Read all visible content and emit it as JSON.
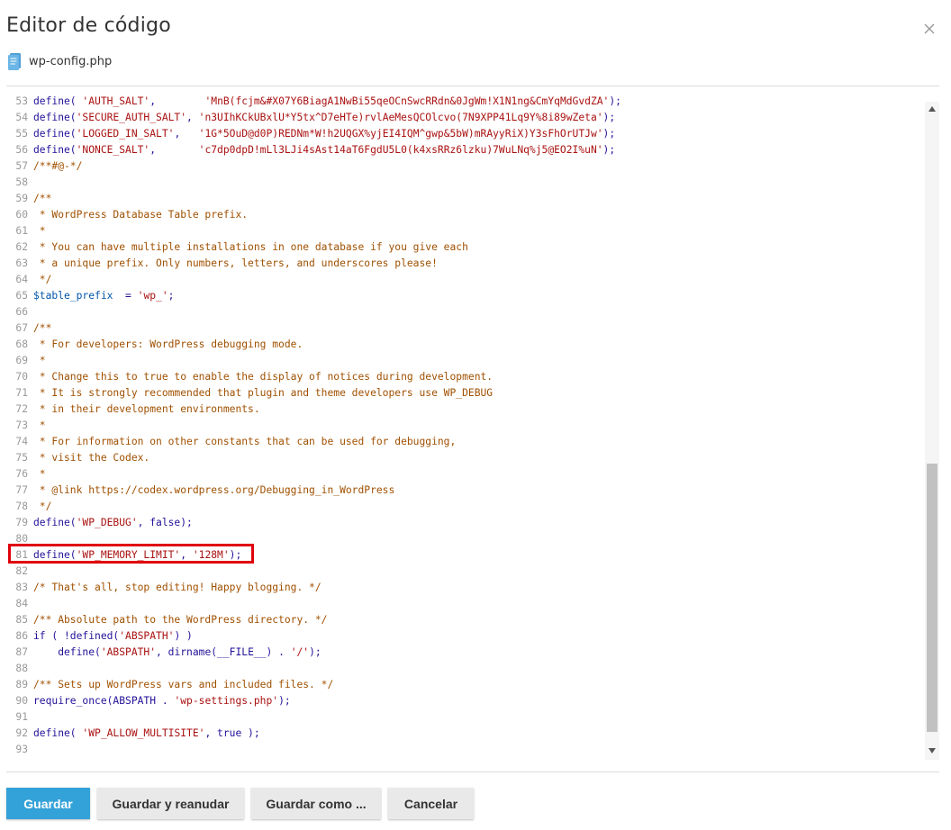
{
  "dialog": {
    "title": "Editor de código",
    "filename": "wp-config.php"
  },
  "code_lines": [
    {
      "n": "53",
      "t": [
        [
          "plain",
          "define( "
        ],
        [
          "str",
          "'AUTH_SALT'"
        ],
        [
          "plain",
          ",        "
        ],
        [
          "str",
          "'MnB(fcjm&#X07Y6BiagA1NwBi55qeOCnSwcRRdn&0JgWm!X1N1ng&CmYqMdGvdZA'"
        ],
        [
          "plain",
          ");"
        ]
      ]
    },
    {
      "n": "54",
      "t": [
        [
          "plain",
          "define("
        ],
        [
          "str",
          "'SECURE_AUTH_SALT'"
        ],
        [
          "plain",
          ", "
        ],
        [
          "str",
          "'n3UIhKCkUBxlU*Y5tx^D7eHTe)rvlAeMesQCOlcvo(7N9XPP41Lq9Y%8i89wZeta'"
        ],
        [
          "plain",
          ");"
        ]
      ]
    },
    {
      "n": "55",
      "t": [
        [
          "plain",
          "define("
        ],
        [
          "str",
          "'LOGGED_IN_SALT'"
        ],
        [
          "plain",
          ",   "
        ],
        [
          "str",
          "'1G*5OuD@d0P)REDNm*W!h2UQGX%yjEI4IQM^gwp&5bW)mRAyyRiX)Y3sFhOrUTJw'"
        ],
        [
          "plain",
          ");"
        ]
      ]
    },
    {
      "n": "56",
      "t": [
        [
          "plain",
          "define("
        ],
        [
          "str",
          "'NONCE_SALT'"
        ],
        [
          "plain",
          ",       "
        ],
        [
          "str",
          "'c7dp0dpD!mLl3LJi4sAst14aT6FgdU5L0(k4xsRRz6lzku)7WuLNq%j5@EO2I%uN'"
        ],
        [
          "plain",
          ");"
        ]
      ]
    },
    {
      "n": "57",
      "t": [
        [
          "cm",
          "/**#@-*/"
        ]
      ]
    },
    {
      "n": "58",
      "t": []
    },
    {
      "n": "59",
      "t": [
        [
          "cm",
          "/**"
        ]
      ]
    },
    {
      "n": "60",
      "t": [
        [
          "cm",
          " * WordPress Database Table prefix."
        ]
      ]
    },
    {
      "n": "61",
      "t": [
        [
          "cm",
          " *"
        ]
      ]
    },
    {
      "n": "62",
      "t": [
        [
          "cm",
          " * You can have multiple installations in one database if you give each"
        ]
      ]
    },
    {
      "n": "63",
      "t": [
        [
          "cm",
          " * a unique prefix. Only numbers, letters, and underscores please!"
        ]
      ]
    },
    {
      "n": "64",
      "t": [
        [
          "cm",
          " */"
        ]
      ]
    },
    {
      "n": "65",
      "t": [
        [
          "var",
          "$table_prefix"
        ],
        [
          "plain",
          "  = "
        ],
        [
          "str",
          "'wp_'"
        ],
        [
          "plain",
          ";"
        ]
      ]
    },
    {
      "n": "66",
      "t": []
    },
    {
      "n": "67",
      "t": [
        [
          "cm",
          "/**"
        ]
      ]
    },
    {
      "n": "68",
      "t": [
        [
          "cm",
          " * For developers: WordPress debugging mode."
        ]
      ]
    },
    {
      "n": "69",
      "t": [
        [
          "cm",
          " *"
        ]
      ]
    },
    {
      "n": "70",
      "t": [
        [
          "cm",
          " * Change this to true to enable the display of notices during development."
        ]
      ]
    },
    {
      "n": "71",
      "t": [
        [
          "cm",
          " * It is strongly recommended that plugin and theme developers use WP_DEBUG"
        ]
      ]
    },
    {
      "n": "72",
      "t": [
        [
          "cm",
          " * in their development environments."
        ]
      ]
    },
    {
      "n": "73",
      "t": [
        [
          "cm",
          " *"
        ]
      ]
    },
    {
      "n": "74",
      "t": [
        [
          "cm",
          " * For information on other constants that can be used for debugging,"
        ]
      ]
    },
    {
      "n": "75",
      "t": [
        [
          "cm",
          " * visit the Codex."
        ]
      ]
    },
    {
      "n": "76",
      "t": [
        [
          "cm",
          " *"
        ]
      ]
    },
    {
      "n": "77",
      "t": [
        [
          "cm",
          " * @link https://codex.wordpress.org/Debugging_in_WordPress"
        ]
      ]
    },
    {
      "n": "78",
      "t": [
        [
          "cm",
          " */"
        ]
      ]
    },
    {
      "n": "79",
      "t": [
        [
          "plain",
          "define("
        ],
        [
          "str",
          "'WP_DEBUG'"
        ],
        [
          "plain",
          ", false);"
        ]
      ]
    },
    {
      "n": "80",
      "t": []
    },
    {
      "n": "81",
      "t": [
        [
          "plain",
          "define("
        ],
        [
          "str",
          "'WP_MEMORY_LIMIT'"
        ],
        [
          "plain",
          ", "
        ],
        [
          "str",
          "'128M'"
        ],
        [
          "plain",
          ");"
        ]
      ]
    },
    {
      "n": "82",
      "t": []
    },
    {
      "n": "83",
      "t": [
        [
          "cm",
          "/* That's all, stop editing! Happy blogging. */"
        ]
      ]
    },
    {
      "n": "84",
      "t": []
    },
    {
      "n": "85",
      "t": [
        [
          "cm",
          "/** Absolute path to the WordPress directory. */"
        ]
      ]
    },
    {
      "n": "86",
      "t": [
        [
          "plain",
          "if ( !defined("
        ],
        [
          "str",
          "'ABSPATH'"
        ],
        [
          "plain",
          ") )"
        ]
      ]
    },
    {
      "n": "87",
      "t": [
        [
          "plain",
          "    define("
        ],
        [
          "str",
          "'ABSPATH'"
        ],
        [
          "plain",
          ", dirname(__FILE__) . "
        ],
        [
          "str",
          "'/'"
        ],
        [
          "plain",
          ");"
        ]
      ]
    },
    {
      "n": "88",
      "t": []
    },
    {
      "n": "89",
      "t": [
        [
          "cm",
          "/** Sets up WordPress vars and included files. */"
        ]
      ]
    },
    {
      "n": "90",
      "t": [
        [
          "plain",
          "require_once(ABSPATH . "
        ],
        [
          "str",
          "'wp-settings.php'"
        ],
        [
          "plain",
          ");"
        ]
      ]
    },
    {
      "n": "91",
      "t": []
    },
    {
      "n": "92",
      "t": [
        [
          "plain",
          "define( "
        ],
        [
          "str",
          "'WP_ALLOW_MULTISITE'"
        ],
        [
          "plain",
          ", true );"
        ]
      ]
    },
    {
      "n": "93",
      "t": []
    }
  ],
  "buttons": {
    "save": "Guardar",
    "save_resume": "Guardar y reanudar",
    "save_as": "Guardar como ...",
    "cancel": "Cancelar"
  },
  "colors": {
    "primary": "#33a2d8",
    "highlight": "#e0000b",
    "string": "#aa1111",
    "comment": "#a05000",
    "keyword": "#221199"
  },
  "icons": {
    "close": "close-icon",
    "file": "php-file-icon"
  }
}
